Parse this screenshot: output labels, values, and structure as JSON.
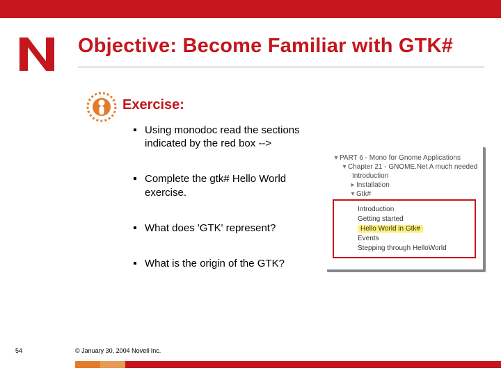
{
  "title": "Objective: Become Familiar with GTK#",
  "exercise_label": "Exercise:",
  "bullets": [
    "Using monodoc read the sections indicated by the red box -->",
    "Complete the gtk# Hello World exercise.",
    "What does 'GTK' represent?",
    "What is the origin of the GTK?"
  ],
  "thumb": {
    "part": "PART 6 - Mono for Gnome Applications",
    "chapter": "Chapter 21 - GNOME.Net   A much needed",
    "intro": "Introduction",
    "install": "Installation",
    "gtk": "Gtk#",
    "r1": "Introduction",
    "r2": "Getting started",
    "r3_hl": "Hello World in Gtk#",
    "r4": "Events",
    "r5": "Stepping through HelloWorld"
  },
  "page_number": "54",
  "copyright": "© January 30, 2004 Novell Inc."
}
